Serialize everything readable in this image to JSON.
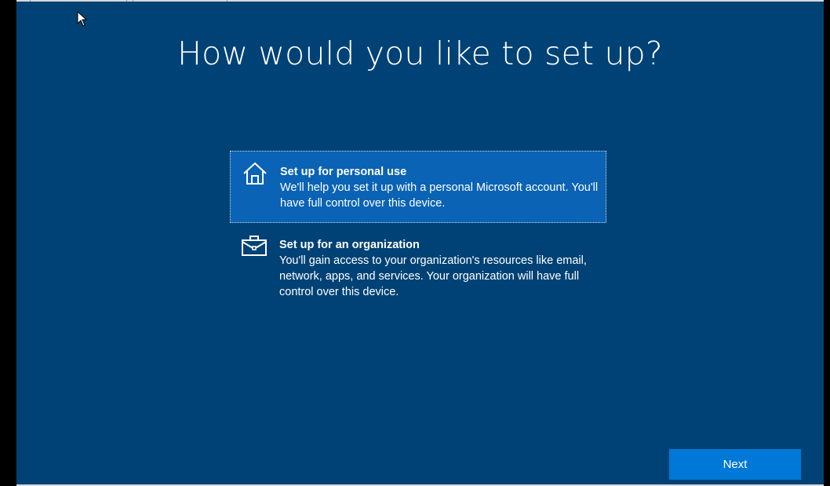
{
  "page": {
    "title": "How would you like to set up?"
  },
  "options": [
    {
      "icon": "home-icon",
      "title": "Set up for personal use",
      "description": "We'll help you set it up with a personal Microsoft account. You'll have full control over this device.",
      "selected": true
    },
    {
      "icon": "briefcase-icon",
      "title": "Set up for an organization",
      "description": "You'll gain access to your organization's resources like email, network, apps, and services. Your organization will have full control over this device.",
      "selected": false
    }
  ],
  "footer": {
    "next_label": "Next"
  },
  "colors": {
    "background": "#004275",
    "selected_option": "#0a63b4",
    "accent_button": "#0078d7",
    "text": "#ffffff"
  }
}
